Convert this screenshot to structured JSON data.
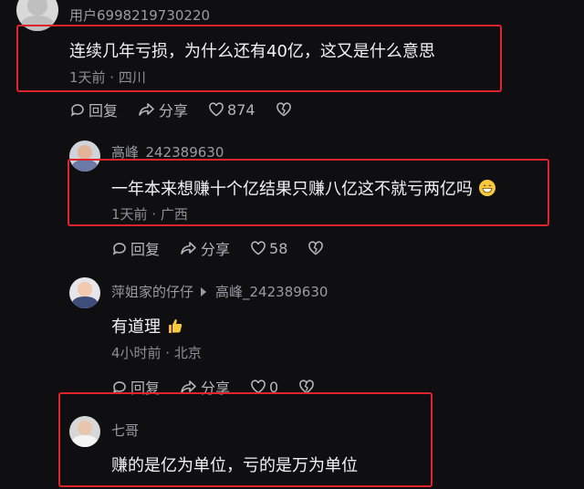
{
  "comments": [
    {
      "username": "用户6998219730220",
      "text": "连续几年亏损，为什么还有40亿，这又是什么意思",
      "meta": "1天前 · 四川",
      "reply_label": "回复",
      "share_label": "分享",
      "likes": "874",
      "avatar_icon": "default-avatar-icon"
    },
    {
      "username": "高峰_242389630",
      "text": "一年本来想赚十个亿结果只赚八亿这不就亏两亿吗",
      "emoji": "grinning-face-icon",
      "meta": "1天前 · 广西",
      "reply_label": "回复",
      "share_label": "分享",
      "likes": "58",
      "avatar_icon": "user-photo-avatar"
    },
    {
      "username": "萍姐家的仔仔",
      "reply_to": "高峰_242389630",
      "text": "有道理",
      "emoji": "thumbs-up-icon",
      "meta": "4小时前 · 北京",
      "reply_label": "回复",
      "share_label": "分享",
      "likes": "0",
      "avatar_icon": "kid-photo-avatar"
    },
    {
      "username": "七哥",
      "text": "赚的是亿为单位，亏的是万为单位",
      "avatar_icon": "man-photo-avatar"
    }
  ],
  "colors": {
    "background": "#0f0f12",
    "highlight_border": "#e0242c",
    "secondary_text": "#9a9aa2"
  }
}
